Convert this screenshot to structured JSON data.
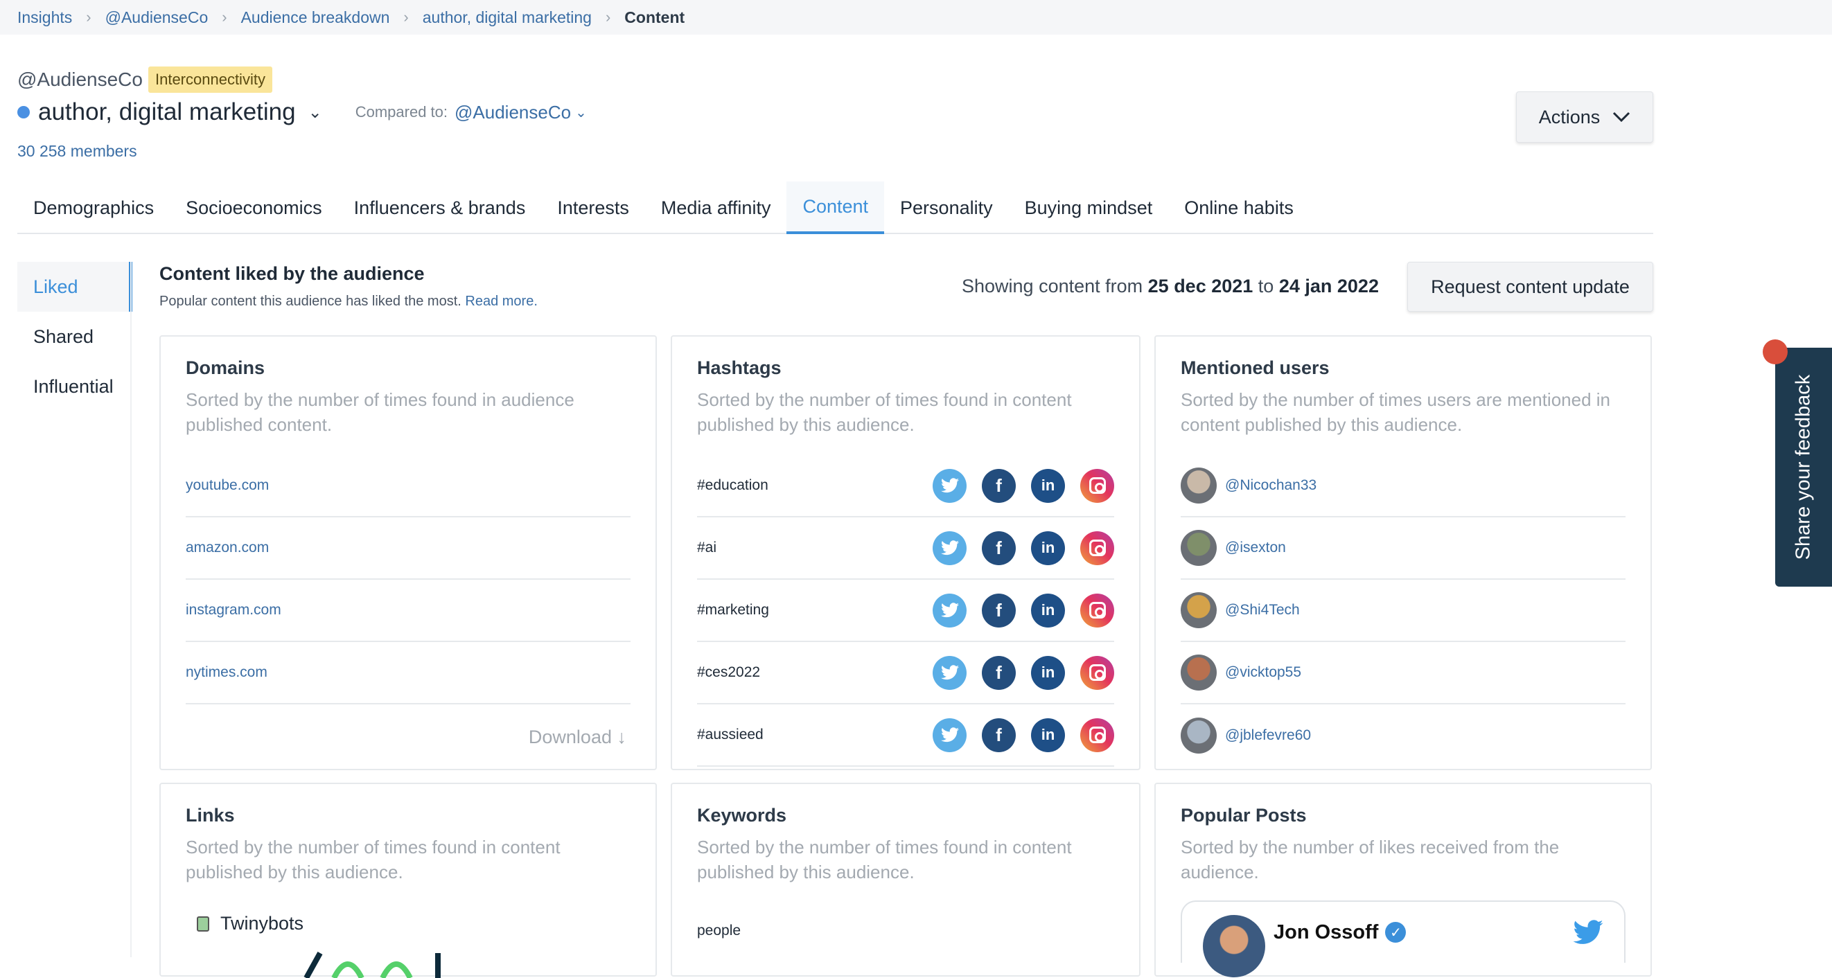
{
  "breadcrumb": [
    {
      "label": "Insights"
    },
    {
      "label": "@AudienseCo"
    },
    {
      "label": "Audience breakdown"
    },
    {
      "label": "author, digital marketing"
    },
    {
      "label": "Content"
    }
  ],
  "header": {
    "handle": "@AudienseCo",
    "badge": "Interconnectivity",
    "audience_name": "author, digital marketing",
    "compared_label": "Compared to:",
    "compared_value": "@AudienseCo",
    "members": "30 258 members",
    "actions_label": "Actions"
  },
  "tabs": [
    "Demographics",
    "Socioeconomics",
    "Influencers & brands",
    "Interests",
    "Media affinity",
    "Content",
    "Personality",
    "Buying mindset",
    "Online habits"
  ],
  "side_nav": [
    "Liked",
    "Shared",
    "Influential"
  ],
  "section": {
    "title": "Content liked by the audience",
    "subtitle": "Popular content this audience has liked the most.",
    "read_more": "Read more.",
    "showing_prefix": "Showing content from",
    "date_from": "25 dec 2021",
    "date_to_word": "to",
    "date_to": "24 jan 2022",
    "request_label": "Request content update"
  },
  "domains": {
    "title": "Domains",
    "desc": "Sorted by the number of times found in audience published content.",
    "items": [
      "youtube.com",
      "amazon.com",
      "instagram.com",
      "nytimes.com"
    ],
    "download": "Download"
  },
  "hashtags": {
    "title": "Hashtags",
    "desc": "Sorted by the number of times found in content published by this audience.",
    "items": [
      "#education",
      "#ai",
      "#marketing",
      "#ces2022",
      "#aussieed"
    ]
  },
  "mentioned": {
    "title": "Mentioned users",
    "desc": "Sorted by the number of times users are mentioned in content published by this audience.",
    "items": [
      "@Nicochan33",
      "@isexton",
      "@Shi4Tech",
      "@vicktop55",
      "@jblefevre60"
    ],
    "avatar_colors": [
      "#c9b9a8",
      "#7f8f6a",
      "#d4a24a",
      "#b8704f",
      "#a9b6c4"
    ]
  },
  "links": {
    "title": "Links",
    "desc": "Sorted by the number of times found in content published by this audience.",
    "first_item": "Twinybots"
  },
  "keywords": {
    "title": "Keywords",
    "desc": "Sorted by the number of times found in content published by this audience.",
    "first_item": "people"
  },
  "popular": {
    "title": "Popular Posts",
    "desc": "Sorted by the number of likes received from the audience.",
    "post_author": "Jon Ossoff"
  },
  "feedback_label": "Share your feedback",
  "icons": {
    "chevron": "chevron-down-icon",
    "download": "arrow-down-icon",
    "twitter": "twitter-icon",
    "facebook": "facebook-icon",
    "linkedin": "linkedin-icon",
    "instagram": "instagram-icon"
  }
}
